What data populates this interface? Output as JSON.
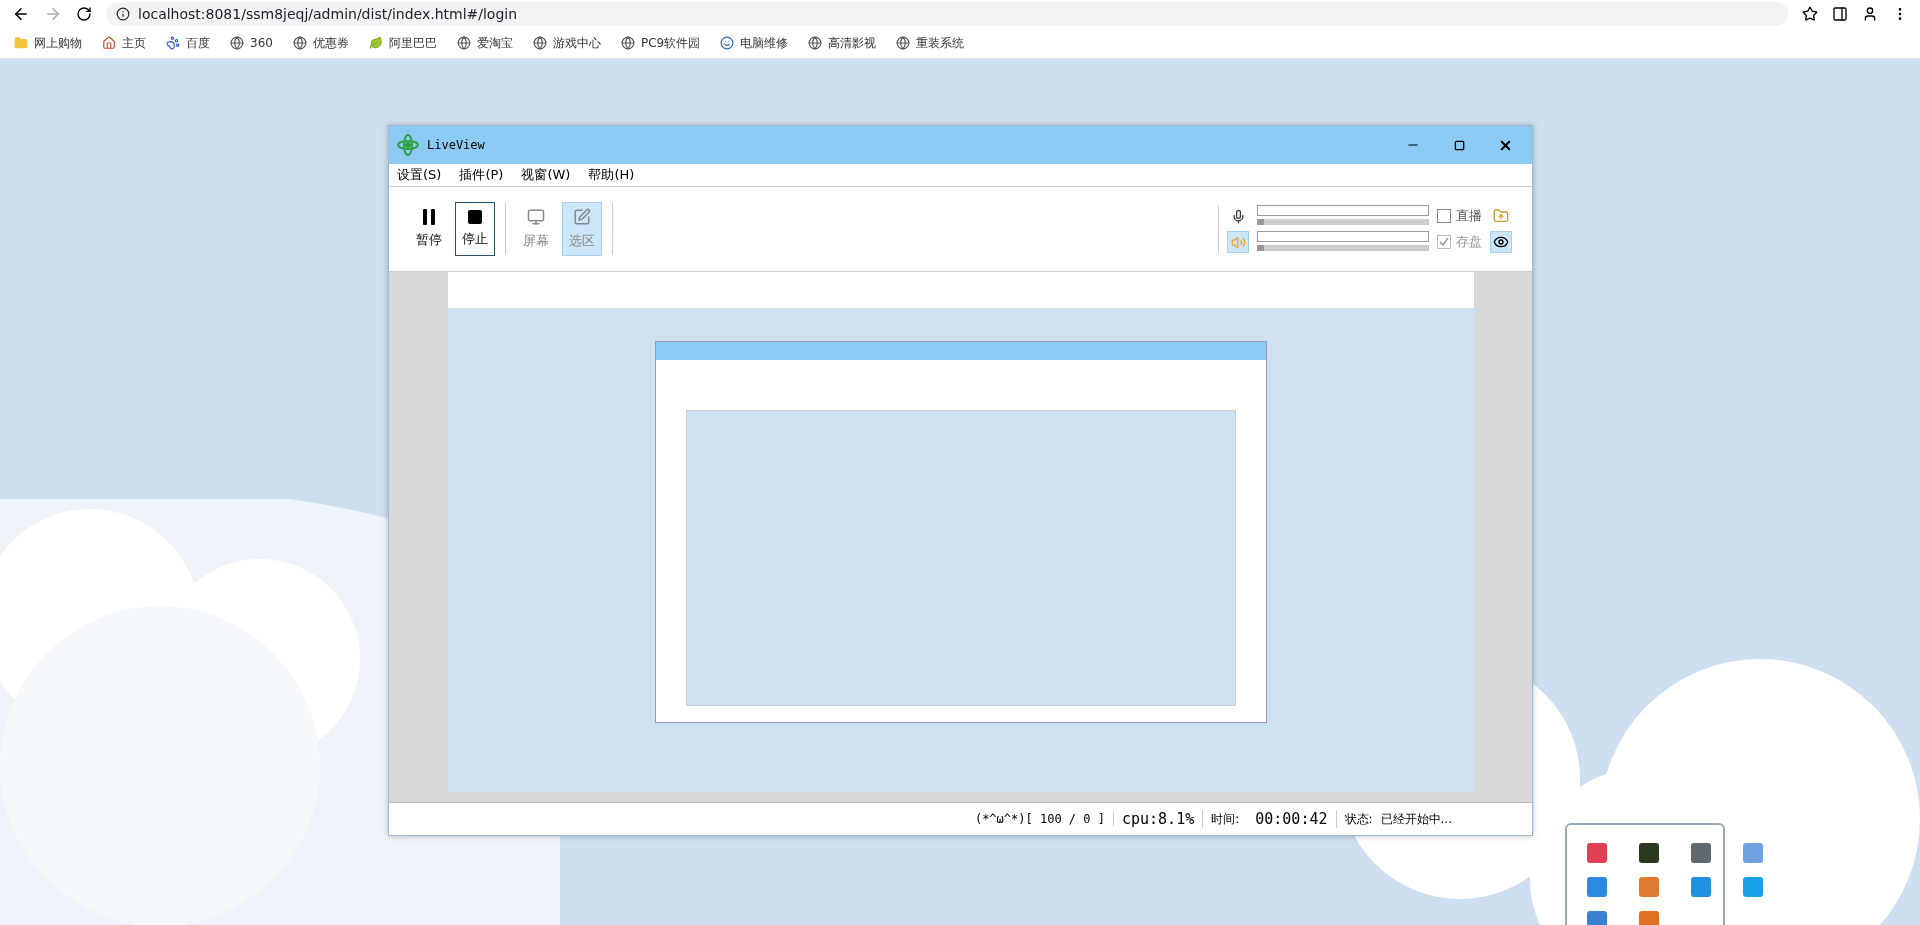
{
  "browser": {
    "url": "localhost:8081/ssm8jeqj/admin/dist/index.html#/login",
    "bookmarks": [
      {
        "label": "网上购物",
        "kind": "folder"
      },
      {
        "label": "主页",
        "kind": "home"
      },
      {
        "label": "百度",
        "kind": "paw"
      },
      {
        "label": "360",
        "kind": "globe"
      },
      {
        "label": "优惠券",
        "kind": "globe"
      },
      {
        "label": "阿里巴巴",
        "kind": "leaf"
      },
      {
        "label": "爱淘宝",
        "kind": "globe"
      },
      {
        "label": "游戏中心",
        "kind": "globe"
      },
      {
        "label": "PC9软件园",
        "kind": "globe"
      },
      {
        "label": "电脑维修",
        "kind": "face"
      },
      {
        "label": "高清影视",
        "kind": "globe"
      },
      {
        "label": "重装系统",
        "kind": "globe"
      }
    ]
  },
  "window": {
    "title": "LiveView",
    "menu": [
      "设置(S)",
      "插件(P)",
      "视窗(W)",
      "帮助(H)"
    ],
    "controls": [
      {
        "label": "暂停",
        "kind": "pause",
        "selected": false
      },
      {
        "label": "停止",
        "kind": "stop",
        "selected": true
      }
    ],
    "modes": [
      {
        "label": "屏幕",
        "kind": "screen",
        "selected": false
      },
      {
        "label": "选区",
        "kind": "region",
        "selected": true
      }
    ],
    "audio": [
      {
        "kind": "mic",
        "selected": false,
        "level": 0.02,
        "option": "直播",
        "checked": false,
        "disabled": false,
        "action": {
          "kind": "folder",
          "selected": false
        }
      },
      {
        "kind": "speaker",
        "selected": true,
        "level": 0.02,
        "option": "存盘",
        "checked": true,
        "disabled": true,
        "action": {
          "kind": "eye",
          "selected": true
        }
      }
    ],
    "status_bar": {
      "counter": "(*^ω^*)[ 100 / 0 ]",
      "cpu": "cpu:8.1%",
      "time_label": "时间:",
      "time": "00:00:42",
      "state_label": "状态:",
      "state": "已经开始中..."
    }
  },
  "tray": [
    {
      "color": "#e04050"
    },
    {
      "color": "#2a3a20"
    },
    {
      "color": "#606870"
    },
    {
      "color": "#70a0e0"
    },
    {
      "color": "#2a8ae0"
    },
    {
      "color": "#e07a30"
    },
    {
      "color": "#2090e0"
    },
    {
      "color": "#1aa0e8"
    },
    {
      "color": "#3a80d0"
    },
    {
      "color": "#e07020"
    }
  ]
}
